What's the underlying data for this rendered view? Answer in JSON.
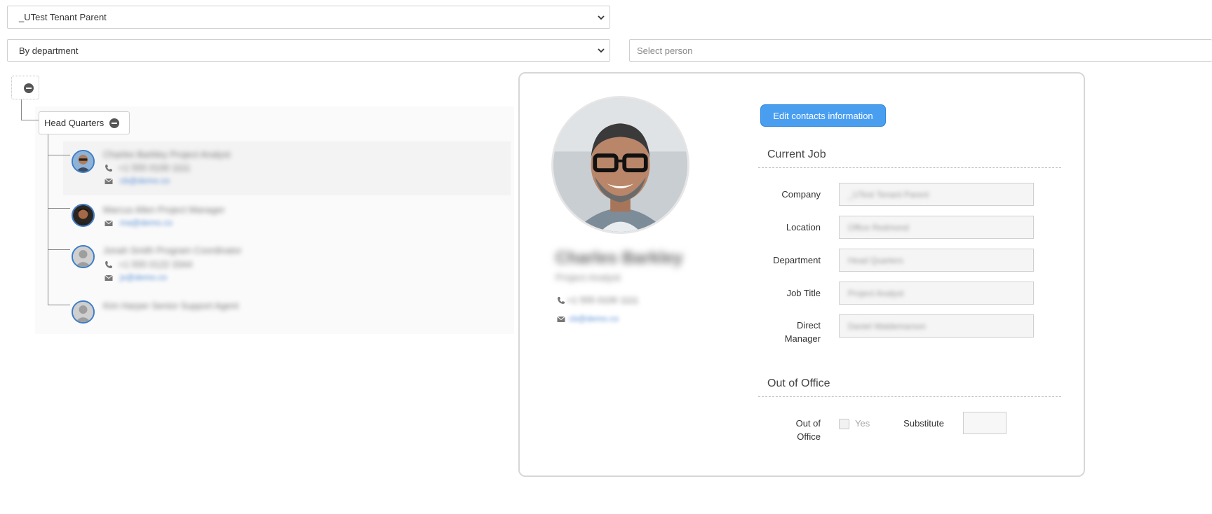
{
  "tenant_select": {
    "value": "_UTest Tenant Parent"
  },
  "grouping_select": {
    "value": "By department"
  },
  "person_search": {
    "placeholder": "Select person"
  },
  "tree": {
    "department_label": "Head Quarters",
    "members": [
      {
        "name": "Charles Barkley Project Analyst",
        "phone": "+1 555 0100 1111",
        "email": "cb@demo.co"
      },
      {
        "name": "Marcus Allen Project Manager",
        "email": "ma@demo.co"
      },
      {
        "name": "Jonah Smith Program Coordinator",
        "phone": "+1 555 0122 3344",
        "email": "js@demo.co"
      },
      {
        "name": "Kim Harper Senior Support Agent"
      }
    ]
  },
  "details": {
    "edit_button_label": "Edit contacts information",
    "person_name": "Charles Barkley",
    "person_title": "Project Analyst",
    "person_phone": "+1 555 0100 1111",
    "person_email": "cb@demo.co",
    "current_job_title": "Current Job",
    "fields": [
      {
        "label": "Company",
        "value": "_UTest Tenant Parent"
      },
      {
        "label": "Location",
        "value": "Office Redmond"
      },
      {
        "label": "Department",
        "value": "Head Quarters"
      },
      {
        "label": "Job Title",
        "value": "Project Analyst"
      },
      {
        "label": "Direct\nManager",
        "value": "Daniel Waldemarson"
      }
    ],
    "out_of_office_title": "Out of Office",
    "ooo_label": "Out of\nOffice",
    "ooo_yes_label": "Yes",
    "substitute_label": "Substitute"
  }
}
